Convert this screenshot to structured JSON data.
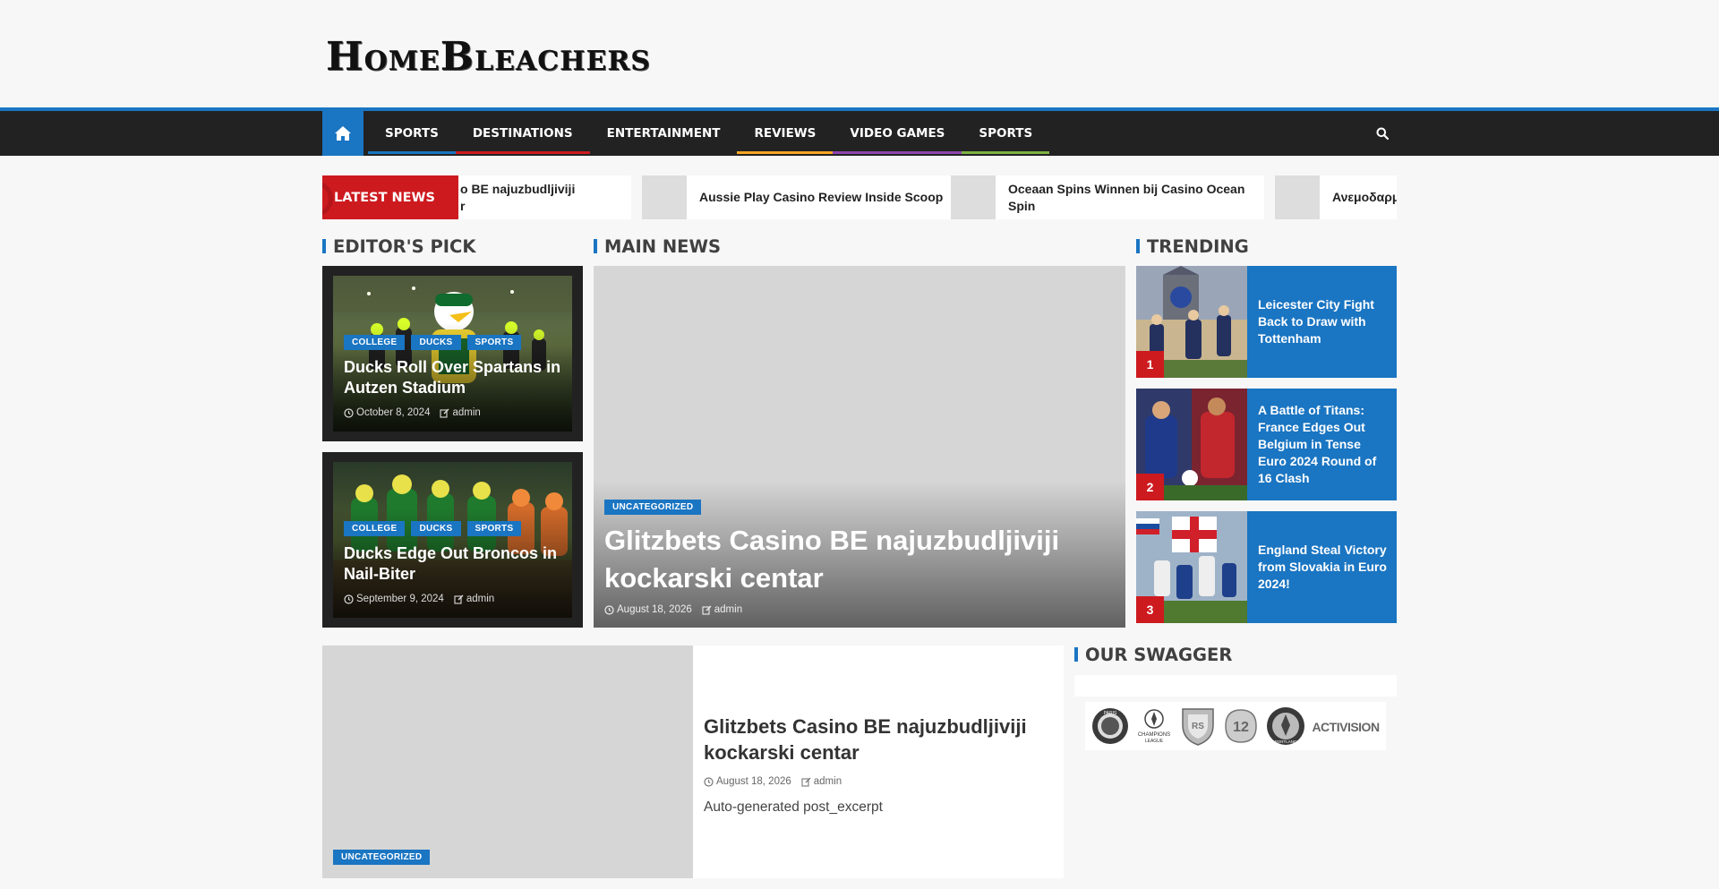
{
  "site": {
    "logo_big1": "H",
    "logo_small1": "OME",
    "logo_big2": "B",
    "logo_small2": "LEACHERS"
  },
  "colors": {
    "accent": "#1a75c2",
    "red": "#cd1a1f",
    "nav_bg": "#222222"
  },
  "nav": {
    "home_icon": "home-icon",
    "items": [
      {
        "label": "SPORTS",
        "color": "#1a75c2"
      },
      {
        "label": "DESTINATIONS",
        "color": "#cd1a1f"
      },
      {
        "label": "ENTERTAINMENT",
        "color": "#222222"
      },
      {
        "label": "REVIEWS",
        "color": "#f5a623"
      },
      {
        "label": "VIDEO GAMES",
        "color": "#8e44ad"
      },
      {
        "label": "SPORTS",
        "color": "#7cb342"
      }
    ],
    "search_icon": "search-icon"
  },
  "ticker": {
    "label": "LATEST NEWS",
    "items": [
      {
        "line1": "o BE najuzbudljiviji",
        "line2": "r"
      },
      {
        "line1": "Aussie Play Casino Review Inside Scoop",
        "line2": ""
      },
      {
        "line1": "Oceaan Spins Winnen bij Casino Ocean",
        "line2": "Spin"
      },
      {
        "line1": "Ανεμοδαρμ",
        "line2": ""
      }
    ]
  },
  "editors_pick": {
    "title": "EDITOR'S PICK",
    "cards": [
      {
        "tags": [
          "COLLEGE",
          "DUCKS",
          "SPORTS"
        ],
        "title": "Ducks Roll Over Spartans in Autzen Stadium",
        "date": "October 8, 2024",
        "author": "admin"
      },
      {
        "tags": [
          "COLLEGE",
          "DUCKS",
          "SPORTS"
        ],
        "title": "Ducks Edge Out Broncos in Nail-Biter",
        "date": "September 9, 2024",
        "author": "admin"
      }
    ]
  },
  "main_news": {
    "title": "MAIN NEWS",
    "post": {
      "tag": "UNCATEGORIZED",
      "title": "Glitzbets Casino BE najuzbudljiviji kockarski centar",
      "date": "August 18, 2026",
      "author": "admin"
    }
  },
  "trending": {
    "title": "TRENDING",
    "items": [
      {
        "num": "1",
        "title": "Leicester City Fight Back to Draw with Tottenham"
      },
      {
        "num": "2",
        "title": "A Battle of Titans: France Edges Out Belgium in Tense Euro 2024 Round of 16 Clash"
      },
      {
        "num": "3",
        "title": "England Steal Victory from Slovakia in Euro 2024!"
      }
    ]
  },
  "feature": {
    "tag": "UNCATEGORIZED",
    "title": "Glitzbets Casino BE najuzbudljiviji kockarski centar",
    "date": "August 18, 2026",
    "author": "admin",
    "excerpt": "Auto-generated post_excerpt"
  },
  "swagger": {
    "title": "OUR SWAGGER",
    "logos": [
      {
        "name": "psg-logo",
        "text": "PARIS"
      },
      {
        "name": "champions-league-logo",
        "text": "CHAMPIONS LEAGUE"
      },
      {
        "name": "shield-logo",
        "text": ""
      },
      {
        "name": "pac12-logo",
        "text": "12"
      },
      {
        "name": "portland-logo",
        "text": "PORTLAND"
      },
      {
        "name": "activision-logo",
        "text": "ACTIVISION"
      }
    ]
  }
}
